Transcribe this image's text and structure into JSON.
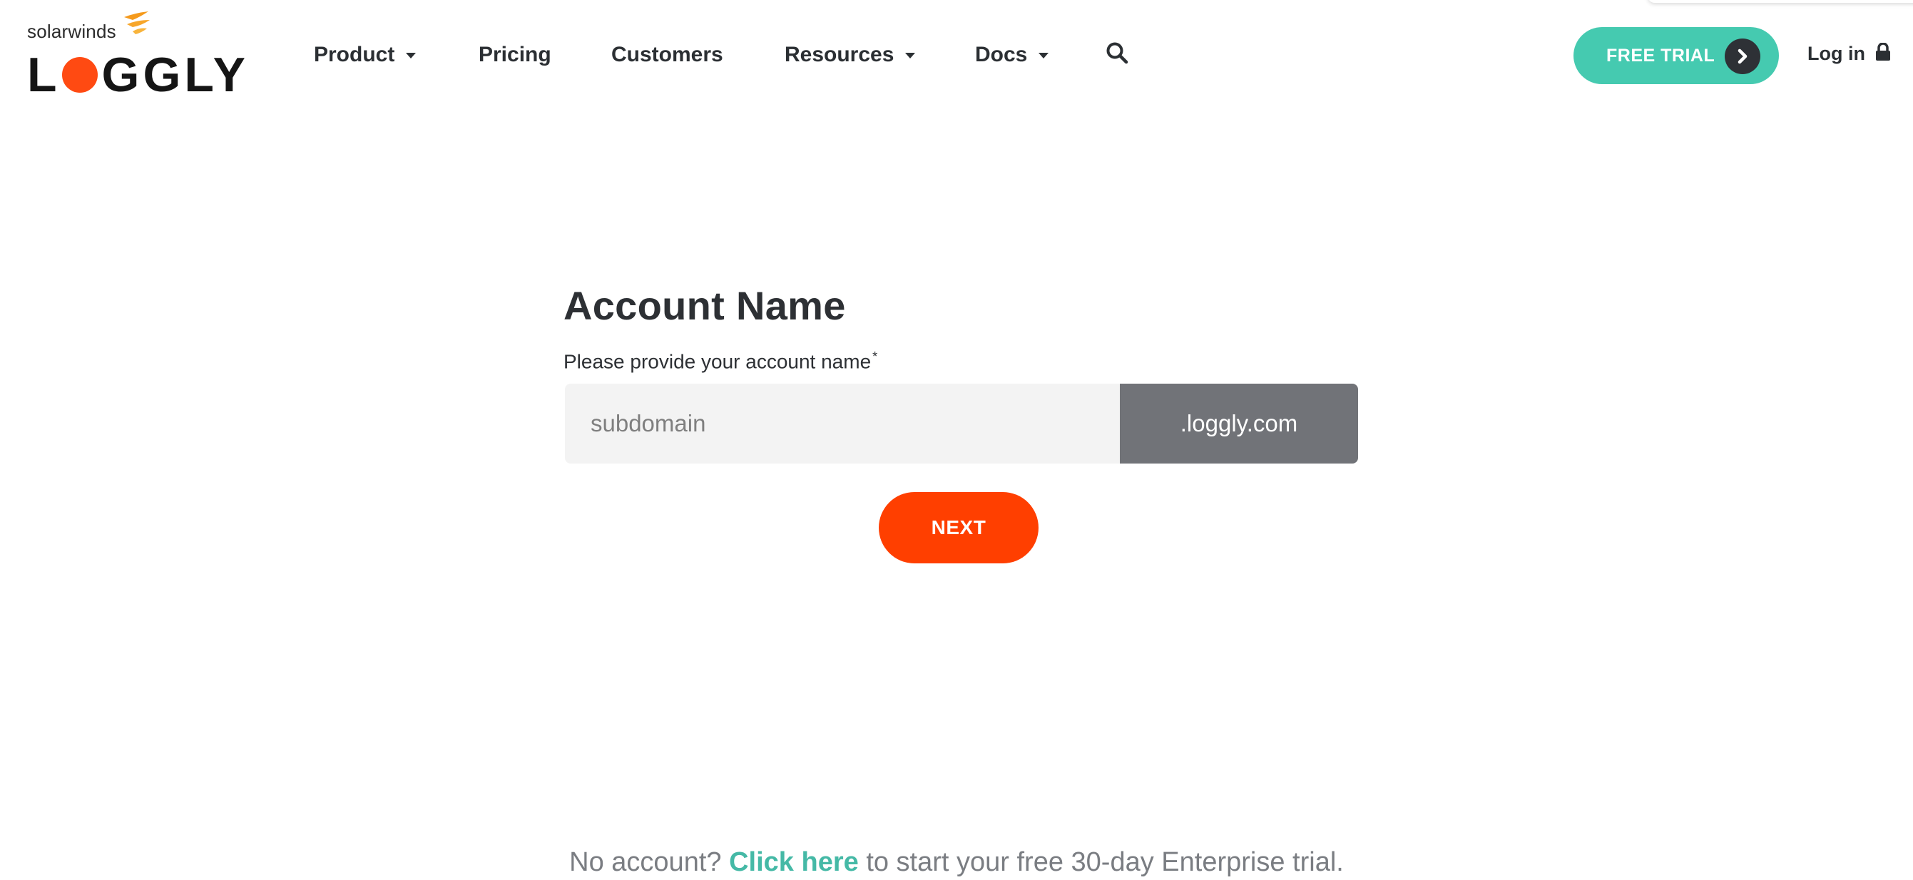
{
  "brand": {
    "company": "solarwinds",
    "product": "LOGGLY",
    "accent_orange": "#ff4a12",
    "accent_teal": "#45cab0"
  },
  "nav": {
    "items": [
      {
        "label": "Product",
        "has_dropdown": true
      },
      {
        "label": "Pricing",
        "has_dropdown": false
      },
      {
        "label": "Customers",
        "has_dropdown": false
      },
      {
        "label": "Resources",
        "has_dropdown": true
      },
      {
        "label": "Docs",
        "has_dropdown": true
      }
    ],
    "search_icon": "search-icon",
    "free_trial_label": "FREE TRIAL",
    "free_trial_icon": "chevron-right-icon",
    "login_label": "Log in",
    "login_icon": "lock-icon"
  },
  "form": {
    "title": "Account Name",
    "label": "Please provide your account name",
    "required_marker": "*",
    "input_placeholder": "subdomain",
    "input_value": "",
    "domain_suffix": ".loggly.com",
    "next_label": "NEXT",
    "next_color": "#ff3f00"
  },
  "footer": {
    "prefix": "No account?",
    "link_label": "Click here",
    "suffix": "to start your free 30-day Enterprise trial."
  }
}
